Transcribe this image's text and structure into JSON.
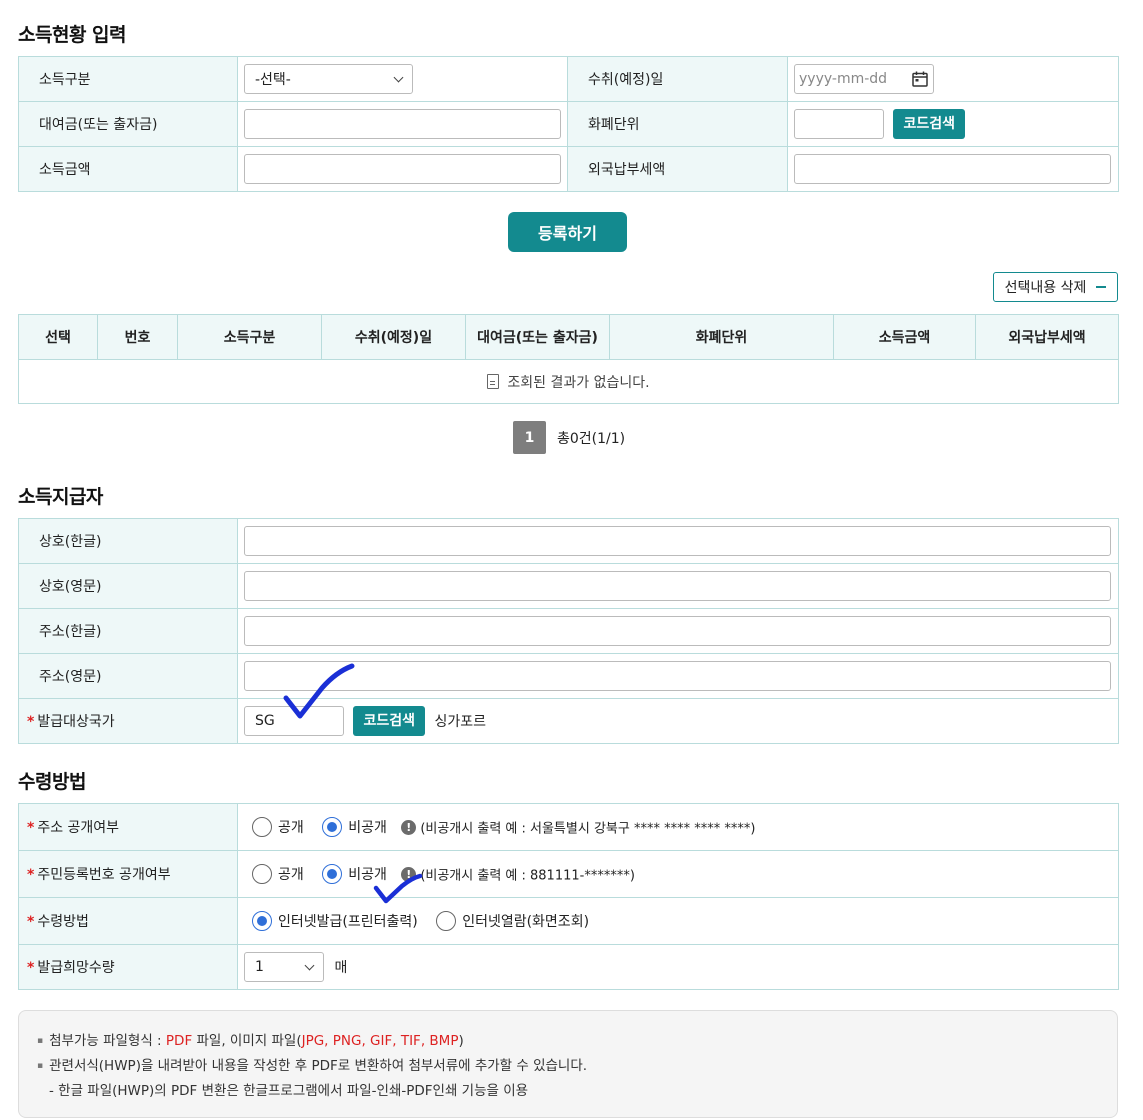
{
  "income_section": {
    "title": "소득현황 입력",
    "fields": {
      "income_type_label": "소득구분",
      "income_type_value": "-선택-",
      "receipt_date_label": "수취(예정)일",
      "receipt_date_placeholder": "yyyy-mm-dd",
      "loan_label": "대여금(또는 출자금)",
      "currency_label": "화폐단위",
      "code_search": "코드검색",
      "income_amount_label": "소득금액",
      "foreign_tax_label": "외국납부세액"
    },
    "register_button": "등록하기",
    "delete_selected_button": "선택내용 삭제"
  },
  "result_table": {
    "headers": [
      "선택",
      "번호",
      "소득구분",
      "수취(예정)일",
      "대여금(또는 출자금)",
      "화폐단위",
      "소득금액",
      "외국납부세액"
    ],
    "empty_message": "조회된 결과가 없습니다."
  },
  "pagination": {
    "current_page": "1",
    "total_text": "총0건(1/1)"
  },
  "payer_section": {
    "title": "소득지급자",
    "name_kr_label": "상호(한글)",
    "name_en_label": "상호(영문)",
    "addr_kr_label": "주소(한글)",
    "addr_en_label": "주소(영문)",
    "country_label": "발급대상국가",
    "country_code_value": "SG",
    "code_search": "코드검색",
    "country_name": "싱가포르",
    "required_mark": "*"
  },
  "receive_section": {
    "title": "수령방법",
    "required_mark": "*",
    "address_public_label": "주소 공개여부",
    "rrn_public_label": "주민등록번호 공개여부",
    "method_label": "수령방법",
    "quantity_label": "발급희망수량",
    "public_option": "공개",
    "private_option": "비공개",
    "info_icon": "!",
    "address_hint": "(비공개시 출력 예 : 서울특별시 강북구 **** **** **** ****)",
    "rrn_hint": "(비공개시 출력 예 : 881111-*******)",
    "method_internet_issue": "인터넷발급(프린터출력)",
    "method_internet_view": "인터넷열람(화면조회)",
    "quantity_value": "1",
    "quantity_unit": "매",
    "selected": {
      "address_public": "비공개",
      "rrn_public": "비공개",
      "method": "인터넷발급(프린터출력)"
    }
  },
  "notice": {
    "line1_prefix": "첨부가능 파일형식 : ",
    "line1_pdf": "PDF",
    "line1_mid": " 파일, 이미지 파일(",
    "line1_formats": "JPG, PNG, GIF, TIF, BMP",
    "line1_suffix": ")",
    "line2": "관련서식(HWP)을 내려받아 내용을 작성한 후 PDF로 변환하여 첨부서류에 추가할 수 있습니다.",
    "line3": "- 한글 파일(HWP)의 PDF 변환은 한글프로그램에서 파일-인쇄-PDF인쇄 기능을 이용"
  },
  "colors": {
    "accent": "#138a8f",
    "label_bg": "#eef8f8",
    "border": "#b9dcdc",
    "radio_selected": "#2f6fd8",
    "required": "#dd2222",
    "annotation_ink": "#1a2fd6"
  }
}
